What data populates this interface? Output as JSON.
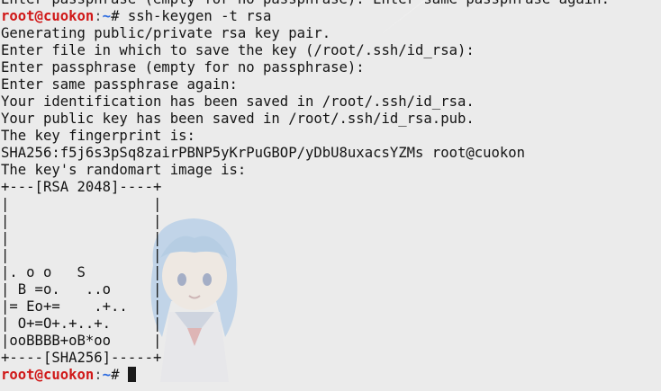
{
  "prompt": {
    "user": "root@cuokon",
    "colon": ":",
    "path": "~",
    "symbol": "# "
  },
  "lines": [
    "Enter passphrase (empty for no passphrase): Enter same passphrase again:",
    {
      "type": "prompt",
      "command": "ssh-keygen -t rsa"
    },
    "Generating public/private rsa key pair.",
    "Enter file in which to save the key (/root/.ssh/id_rsa):",
    "Enter passphrase (empty for no passphrase):",
    "Enter same passphrase again:",
    "Your identification has been saved in /root/.ssh/id_rsa.",
    "Your public key has been saved in /root/.ssh/id_rsa.pub.",
    "The key fingerprint is:",
    "SHA256:f5j6s3pSq8zairPBNP5yKrPuGBOP/yDbU8uxacsYZMs root@cuokon",
    "The key's randomart image is:",
    "+---[RSA 2048]----+",
    "|                 |",
    "|                 |",
    "|                 |",
    "|                 |",
    "|. o o   S        |",
    "| B =o.   ..o     |",
    "|= Eo+=    .+..   |",
    "| O+=O+.+..+.     |",
    "|ooBBBB+oB*oo     |",
    "+----[SHA256]-----+",
    {
      "type": "prompt",
      "command": "",
      "cursor": true
    }
  ]
}
